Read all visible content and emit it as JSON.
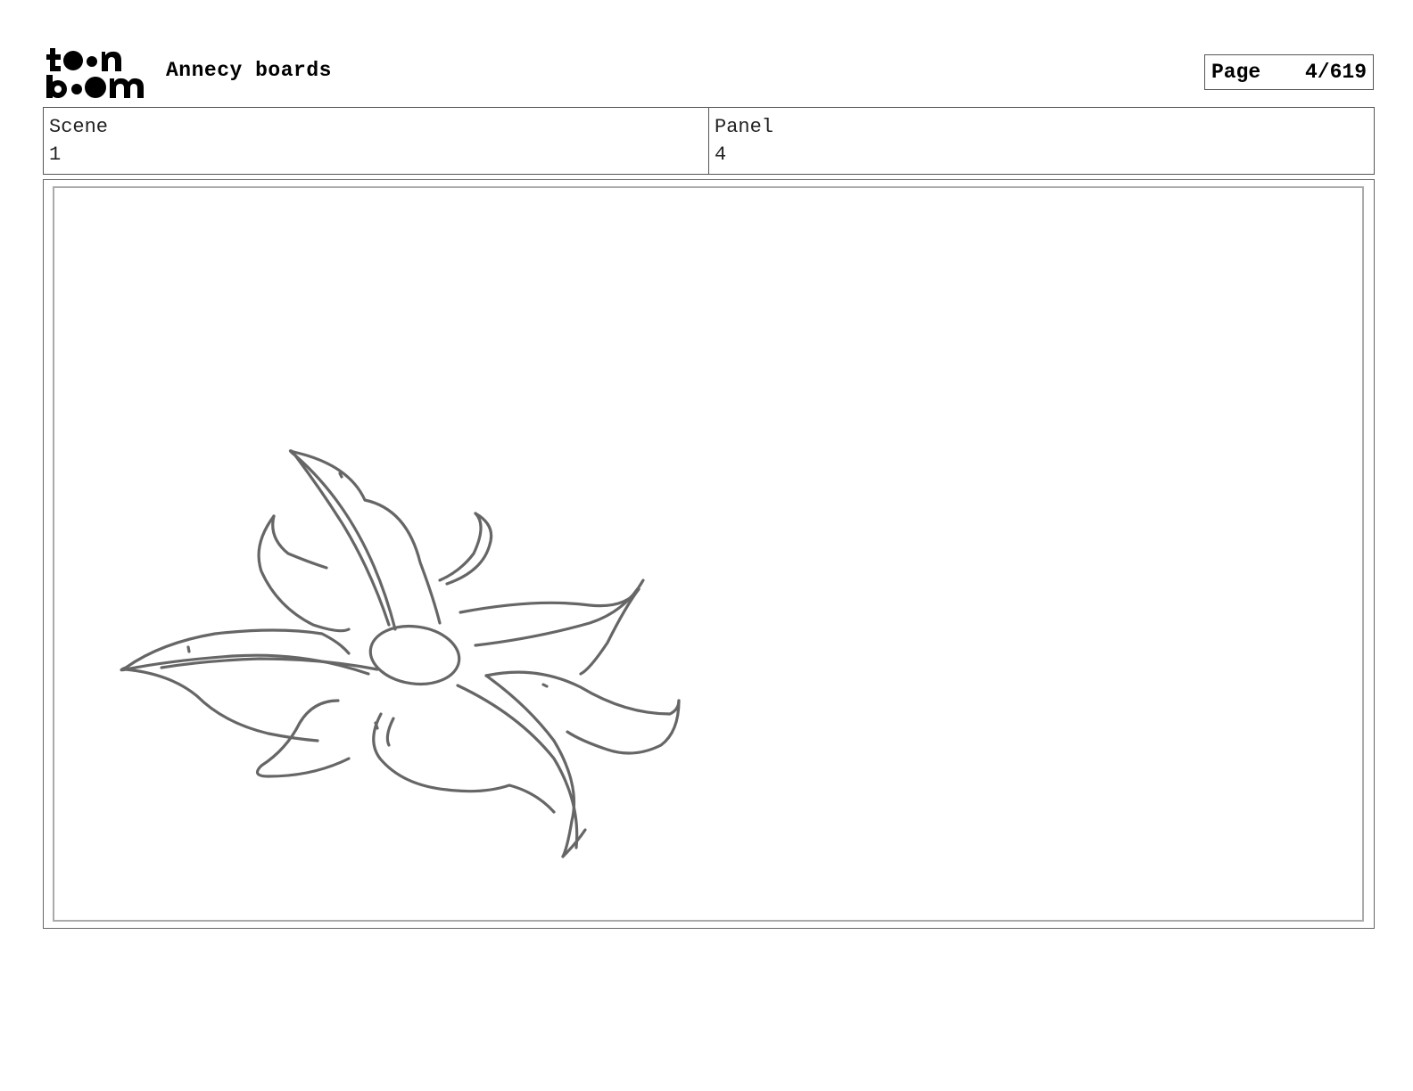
{
  "header": {
    "logo_text": "toon boom",
    "title": "Annecy boards",
    "page_label": "Page",
    "page_value": "4/619"
  },
  "info": {
    "scene_label": "Scene",
    "scene_value": "1",
    "panel_label": "Panel",
    "panel_value": "4"
  },
  "panel": {
    "sketch": "flower-sketch",
    "stroke_color": "#666666"
  }
}
